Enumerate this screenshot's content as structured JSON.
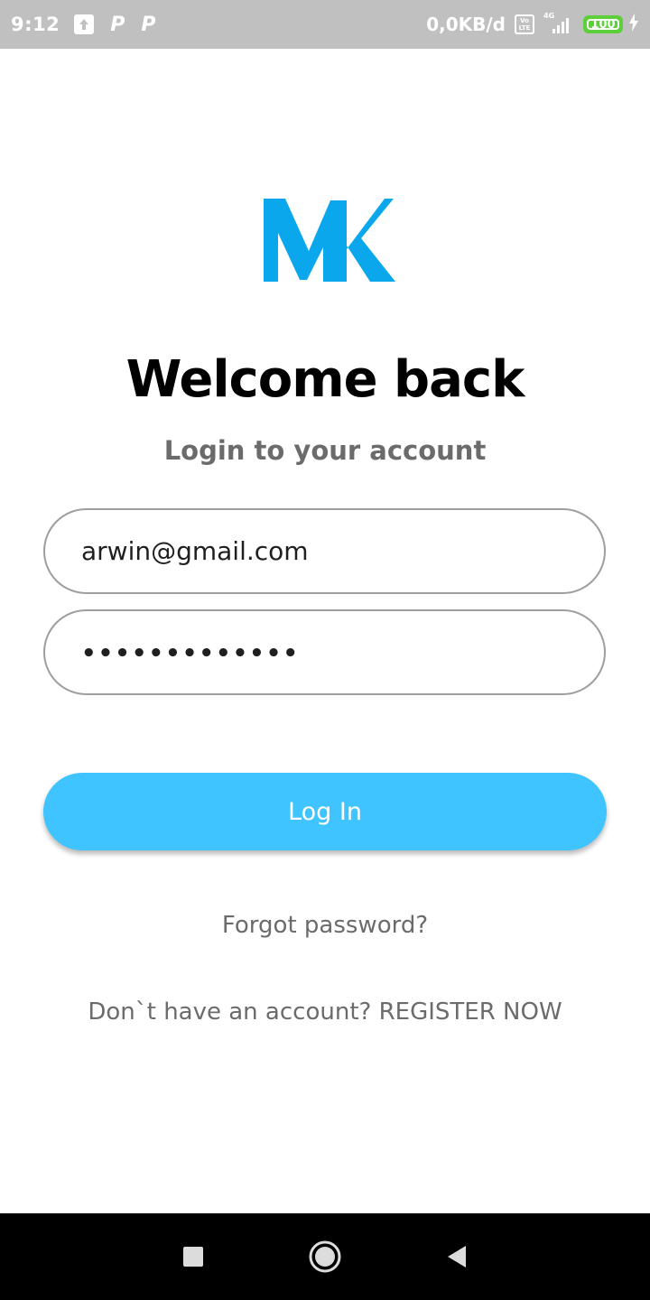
{
  "status_bar": {
    "time": "9:12",
    "p_icon_1": "P",
    "p_icon_2": "P",
    "speed": "0,0KB/d",
    "volte_line1": "Vo",
    "volte_line2": "LTE",
    "network": "4G",
    "battery": "100",
    "icons": [
      "upload-icon",
      "parking-icon",
      "parking-icon",
      "volte-icon",
      "signal-icon",
      "battery-icon",
      "charging-bolt-icon"
    ]
  },
  "logo": {
    "icon": "mk-logo",
    "color": "#0aa7ed"
  },
  "login": {
    "title": "Welcome back",
    "subtitle": "Login to your account",
    "email_value": "arwin@gmail.com",
    "password_masked": "•••••••••••••",
    "login_label": "Log In",
    "forgot_label": "Forgot password?",
    "register_label": "Don`t have an account? REGISTER NOW"
  },
  "nav": {
    "icons": [
      "recents-icon",
      "home-icon",
      "back-icon"
    ]
  },
  "colors": {
    "accent": "#40c4ff",
    "status_bar": "#c0c0c0",
    "battery": "#5ccf3a",
    "text_muted": "#6b6b6b"
  }
}
